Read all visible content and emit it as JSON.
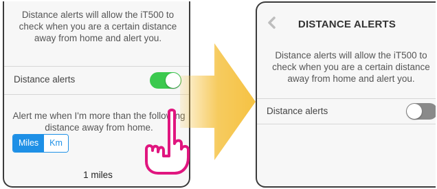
{
  "left_screen": {
    "description": "Distance alerts will allow the iT500 to check when you are a certain distance away from home and alert you.",
    "toggle_label": "Distance alerts",
    "toggle_state": "on",
    "alert_prompt": "Alert me when I'm more than the following distance away from home.",
    "units": {
      "miles": "Miles",
      "km": "Km",
      "selected": "Miles"
    },
    "distance_value": "1 miles"
  },
  "right_screen": {
    "back_icon": "chevron-left-icon",
    "title": "DISTANCE ALERTS",
    "description": "Distance alerts will allow the iT500 to check when you are a certain distance away from home and alert you.",
    "toggle_label": "Distance alerts",
    "toggle_state": "off"
  },
  "colors": {
    "toggle_on": "#3cc94f",
    "toggle_off": "#8a8a8a",
    "segment_accent": "#1e90e6",
    "arrow": "#f5c243",
    "hand_outline": "#e0167f"
  }
}
